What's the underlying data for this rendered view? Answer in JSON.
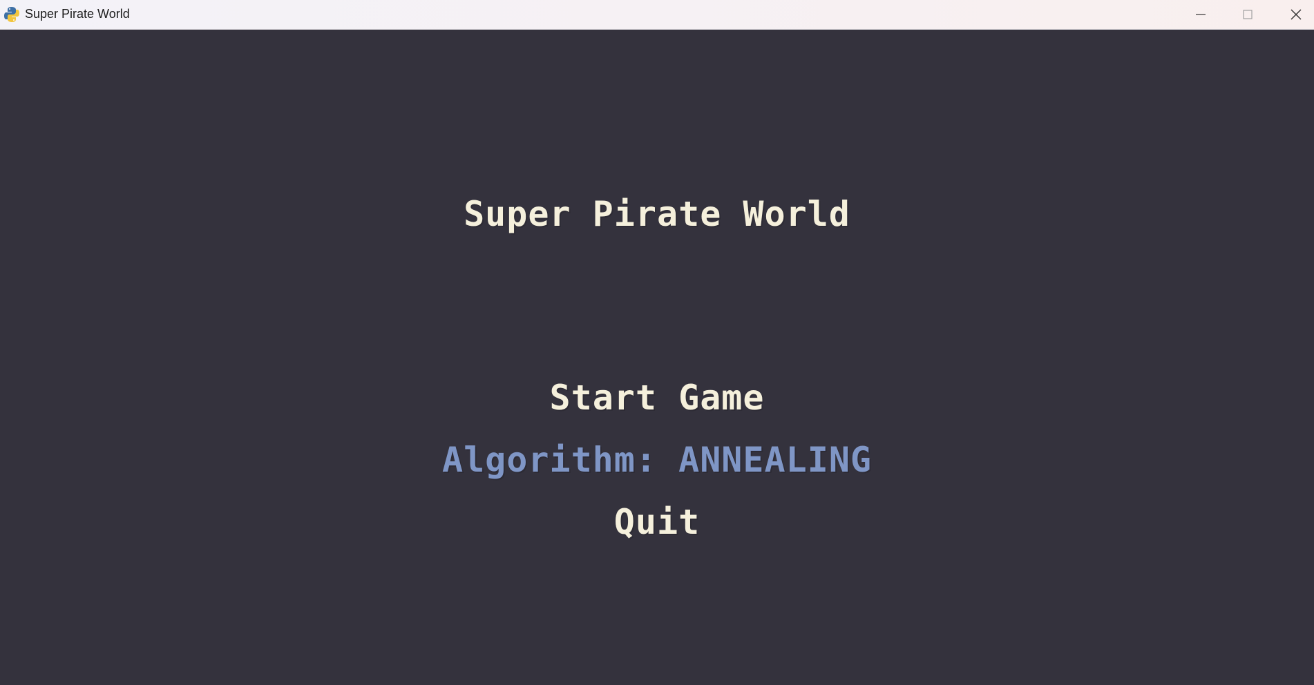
{
  "window": {
    "title": "Super Pirate World",
    "icon": "python-icon",
    "controls": [
      "minimize-icon",
      "maximize-icon",
      "close-icon"
    ]
  },
  "game": {
    "title": "Super Pirate World",
    "menu": {
      "start": "Start Game",
      "algorithm": "Algorithm: ANNEALING",
      "quit": "Quit"
    },
    "colors": {
      "background": "#34323d",
      "text": "#f5f0dc",
      "selected": "#7f96c6"
    }
  }
}
